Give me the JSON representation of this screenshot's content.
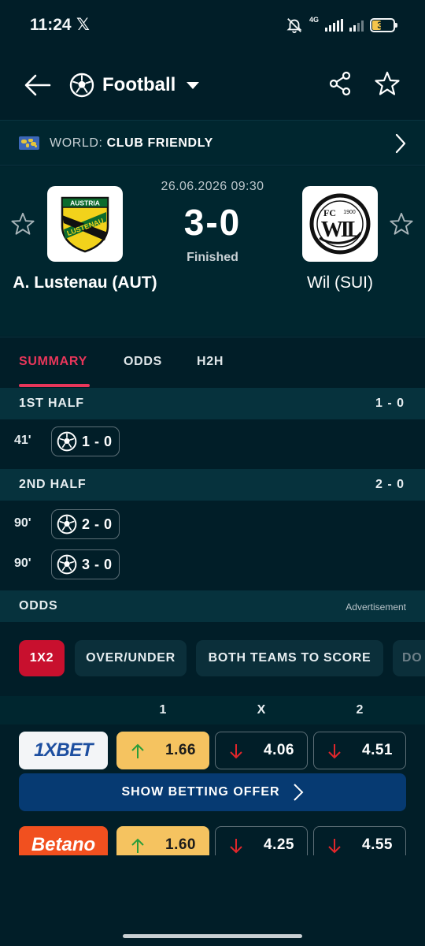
{
  "status_bar": {
    "time": "11:24",
    "x_icon": "x-logo",
    "network": "4G",
    "battery": "36"
  },
  "header": {
    "sport": "Football",
    "icons": [
      "back-arrow",
      "soccer-ball",
      "dropdown-caret",
      "share",
      "star"
    ]
  },
  "league": {
    "prefix": "WORLD: ",
    "name": "CLUB FRIENDLY"
  },
  "match": {
    "datetime": "26.06.2026 09:30",
    "score": "3-0",
    "status": "Finished",
    "home": {
      "name": "A. Lustenau (AUT)",
      "logo_text_top": "AUSTRIA",
      "logo_text_band": "LUSTENAU"
    },
    "away": {
      "name": "Wil (SUI)",
      "logo_text": "FC",
      "logo_year": "1900",
      "logo_letters": "WIL"
    }
  },
  "tabs": [
    "SUMMARY",
    "ODDS",
    "H2H"
  ],
  "summary": {
    "first_half": {
      "label": "1ST HALF",
      "score": "1 - 0",
      "events": [
        {
          "minute": "41'",
          "score": "1 - 0"
        }
      ]
    },
    "second_half": {
      "label": "2ND HALF",
      "score": "2 - 0",
      "events": [
        {
          "minute": "90'",
          "score": "2 - 0"
        },
        {
          "minute": "90'",
          "score": "3 - 0"
        }
      ]
    }
  },
  "odds": {
    "label": "ODDS",
    "ad_label": "Advertisement",
    "markets": [
      "1X2",
      "OVER/UNDER",
      "BOTH TEAMS TO SCORE",
      "DO"
    ],
    "columns": [
      "1",
      "X",
      "2"
    ],
    "bookmakers": [
      {
        "name": "1XBET",
        "odds": [
          "1.66",
          "4.06",
          "4.51"
        ],
        "trend": [
          "up",
          "down",
          "down"
        ]
      },
      {
        "name": "Betano",
        "odds": [
          "1.60",
          "4.25",
          "4.55"
        ],
        "trend": [
          "up",
          "down",
          "down"
        ]
      }
    ],
    "offer_button": "SHOW BETTING OFFER"
  },
  "colors": {
    "background": "#011e28",
    "panel": "#00262f",
    "accent_red": "#e8365a",
    "chip_active": "#c8102e",
    "odds_highlight": "#f5c360",
    "offer_blue": "#063a72"
  }
}
